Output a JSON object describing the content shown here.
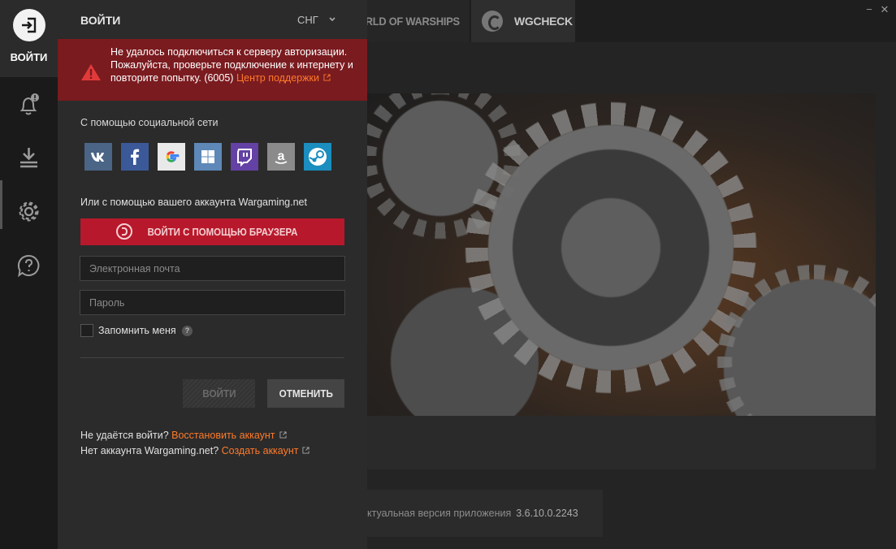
{
  "background": {
    "tabs": [
      {
        "label": "ORLD OF WARSHIPS"
      },
      {
        "label": "WGCHECK"
      }
    ],
    "window": {
      "minimize": "−",
      "close": "✕"
    },
    "version": {
      "label": "ктуальная версия приложения",
      "number": "3.6.10.0.2243"
    }
  },
  "nav": {
    "login_label": "ВОЙТИ",
    "icons": [
      "login-icon",
      "notifications-bell-icon",
      "download-icon",
      "settings-gear-icon",
      "help-chat-icon"
    ]
  },
  "panel": {
    "title": "ВОЙТИ",
    "region": "СНГ",
    "error": {
      "message": "Не удалось подключиться к серверу авторизации. Пожалуйста, проверьте подключение к интернету и повторите попытку. (6005)",
      "link": "Центр поддержки"
    },
    "social_label": "С помощью социальной сети",
    "social": [
      "vk",
      "facebook",
      "google",
      "windows",
      "twitch",
      "amazon",
      "steam"
    ],
    "wg_label": "Или с помощью вашего аккаунта Wargaming.net",
    "browser_button": "ВОЙТИ С ПОМОЩЬЮ БРАУЗЕРА",
    "email_placeholder": "Электронная почта",
    "password_placeholder": "Пароль",
    "remember_label": "Запомнить меня",
    "remember_help": "?",
    "submit_label": "ВОЙТИ",
    "cancel_label": "ОТМЕНИТЬ",
    "restore_prefix": "Не удаётся войти?",
    "restore_link": "Восстановить аккаунт",
    "create_prefix": "Нет аккаунта Wargaming.net?",
    "create_link": "Создать аккаунт"
  },
  "colors": {
    "error_bg": "#7a1b1f",
    "link": "#ff7a2a",
    "primary_button": "#b8182b"
  }
}
